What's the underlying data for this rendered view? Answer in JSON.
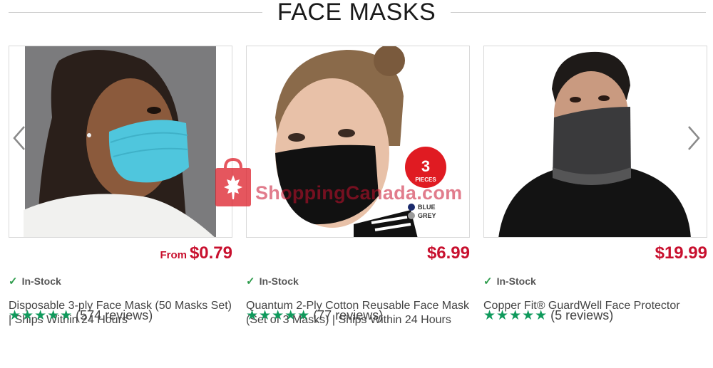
{
  "section": {
    "title": "FACE MASKS"
  },
  "watermark": {
    "text": "ShoppingCanada.com"
  },
  "colors": {
    "price": "#c8102e",
    "stars": "#0f9a5c",
    "check": "#2e9c4c"
  },
  "products": [
    {
      "price_prefix": "From",
      "price": "$0.79",
      "stock": "In-Stock",
      "name": "Disposable 3-ply Face Mask (50 Masks Set) | Ships Within 24 Hours",
      "stars": "★★★★★",
      "reviews": "(574 reviews)"
    },
    {
      "price_prefix": "",
      "price": "$6.99",
      "stock": "In-Stock",
      "name": "Quantum 2-Ply Cotton Reusable Face Mask (Set of 3 Masks) | Ships Within 24 Hours",
      "stars": "★★★★★",
      "reviews": "(77 reviews)",
      "badge": {
        "number": "3",
        "label": "PIECES"
      },
      "colors_list": [
        "BLUE",
        "GREY"
      ]
    },
    {
      "price_prefix": "",
      "price": "$19.99",
      "stock": "In-Stock",
      "name": "Copper Fit® GuardWell Face Protector",
      "stars": "★★★★★",
      "reviews": "(5 reviews)"
    }
  ],
  "nav": {
    "prev_icon": "chevron-left-icon",
    "next_icon": "chevron-right-icon"
  }
}
